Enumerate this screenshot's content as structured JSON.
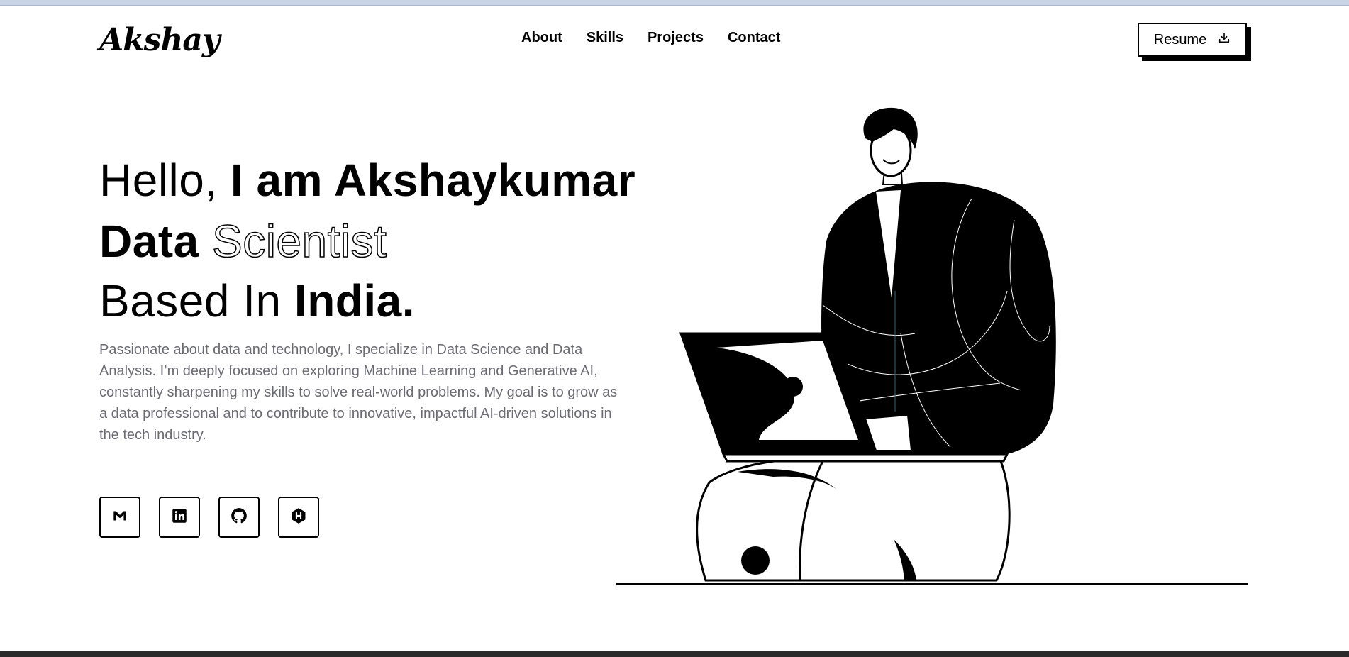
{
  "header": {
    "logo": "Akshay",
    "nav": [
      "About",
      "Skills",
      "Projects",
      "Contact"
    ],
    "resume_label": "Resume",
    "resume_icon": "download-icon"
  },
  "hero": {
    "line1_light": "Hello, ",
    "line1_bold": "I am Akshaykumar",
    "line2_bold": "Data",
    "line2_outline": "Scientist",
    "line3_light": "Based In ",
    "line3_bold": "India.",
    "description": "Passionate about data and technology, I specialize in Data Science and Data Analysis. I’m deeply focused on exploring Machine Learning and Generative AI, constantly sharpening my skills to solve real-world problems. My goal is to grow as a data professional and to contribute to innovative, impactful AI-driven solutions in the tech industry."
  },
  "socials": [
    {
      "name": "gmail-icon"
    },
    {
      "name": "linkedin-icon"
    },
    {
      "name": "github-icon"
    },
    {
      "name": "hackerrank-icon"
    }
  ],
  "colors": {
    "text": "#000000",
    "muted": "#6b6b73",
    "background": "#ffffff"
  }
}
